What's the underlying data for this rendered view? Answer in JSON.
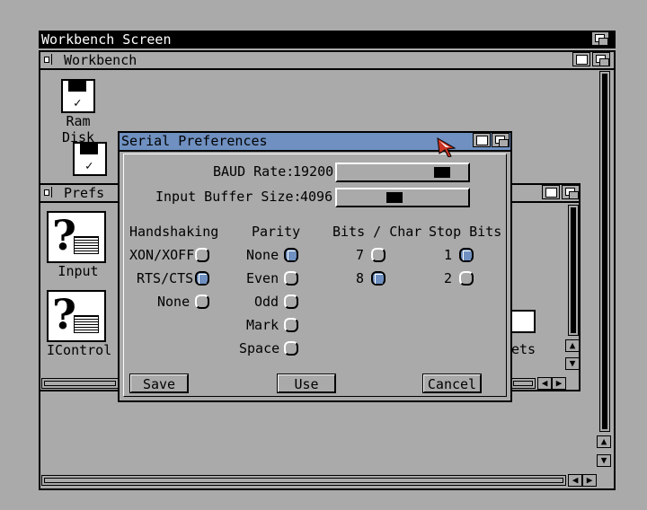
{
  "screen": {
    "title": "Workbench Screen"
  },
  "workbench_window": {
    "title": "Workbench"
  },
  "icons": {
    "ram_disk": "Ram Disk",
    "input": "Input",
    "icontrol": "IControl",
    "presets_partial": "ets"
  },
  "prefs_window": {
    "title": "Prefs"
  },
  "dialog": {
    "title": "Serial Preferences",
    "baud_label": "BAUD Rate:",
    "baud_value": "19200",
    "buffer_label": "Input Buffer Size:",
    "buffer_value": "4096",
    "groups": {
      "handshaking": {
        "title": "Handshaking",
        "options": [
          "XON/XOFF",
          "RTS/CTS",
          "None"
        ],
        "selected": "RTS/CTS"
      },
      "parity": {
        "title": "Parity",
        "options": [
          "None",
          "Even",
          "Odd",
          "Mark",
          "Space"
        ],
        "selected": "None"
      },
      "bits": {
        "title": "Bits / Char",
        "options": [
          "7",
          "8"
        ],
        "selected": "8"
      },
      "stop": {
        "title": "Stop Bits",
        "options": [
          "1",
          "2"
        ],
        "selected": "1"
      }
    },
    "buttons": {
      "save": "Save",
      "use": "Use",
      "cancel": "Cancel"
    }
  },
  "colors": {
    "accent": "#6f90c0",
    "background": "#aaaaaa",
    "pointer": "#cc3322"
  }
}
